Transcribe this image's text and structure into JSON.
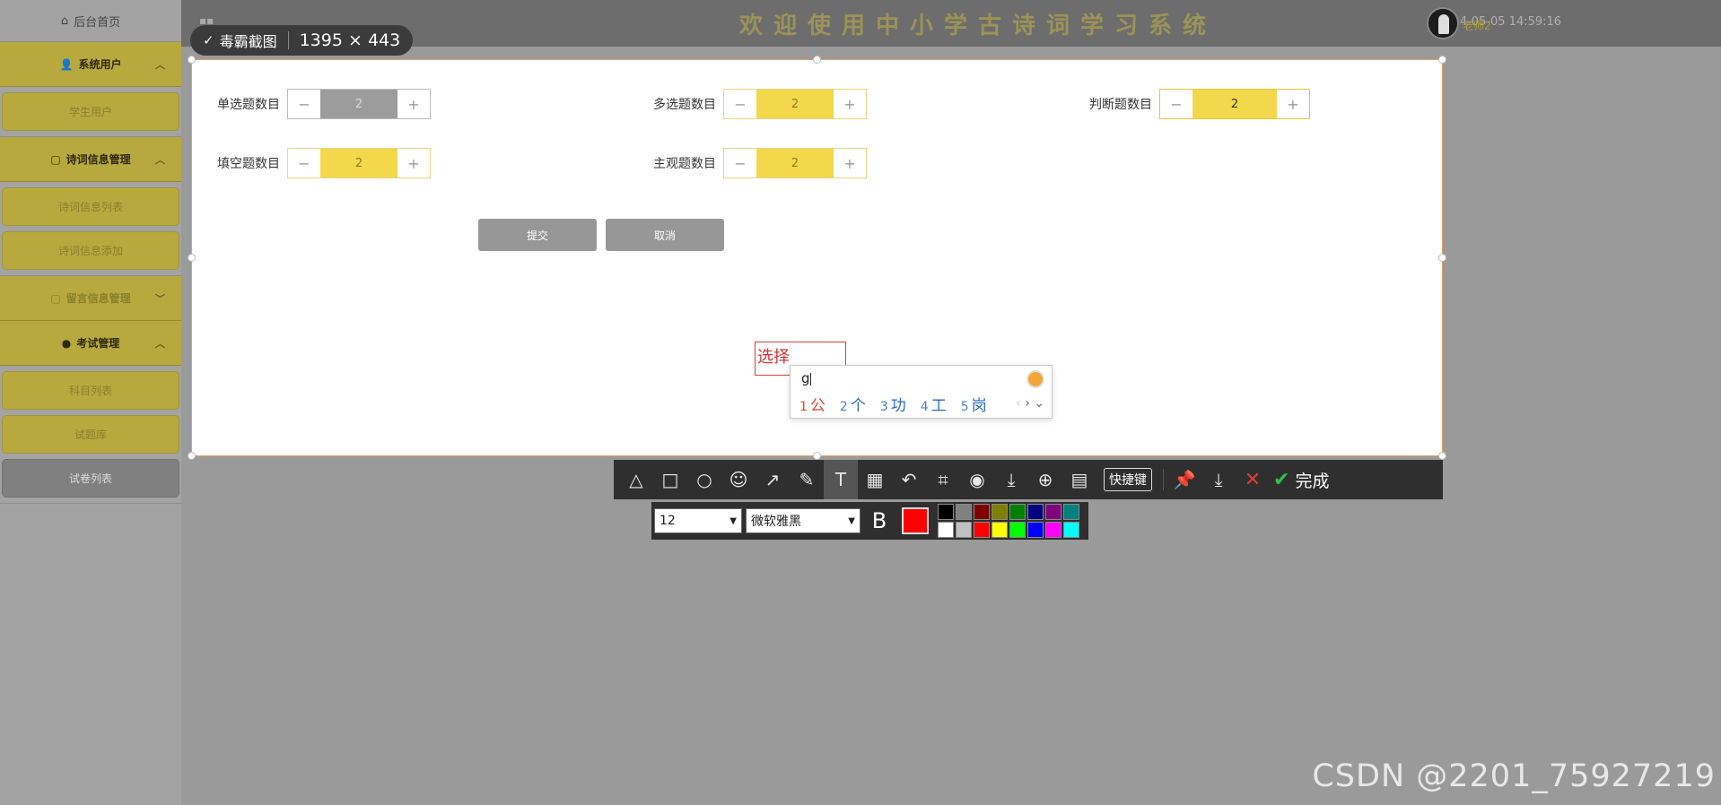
{
  "sidebar": {
    "home": "后台首页",
    "groups": [
      {
        "label": "系统用户",
        "items": [
          "学生用户"
        ]
      },
      {
        "label": "诗词信息管理",
        "items": [
          "诗词信息列表",
          "诗词信息添加"
        ]
      },
      {
        "label": "留言信息管理",
        "items": []
      },
      {
        "label": "考试管理",
        "items": [
          "科目列表",
          "试题库",
          "试卷列表"
        ]
      }
    ]
  },
  "header": {
    "title": "欢迎使用中小学古诗词学习系统",
    "datetime": "2024-05-05 14:59:16",
    "username": "老师2"
  },
  "capture": {
    "app_name": "毒霸截图",
    "dimensions": "1395 × 443"
  },
  "form": {
    "fields": [
      {
        "label": "单选题数目",
        "value": "2"
      },
      {
        "label": "多选题数目",
        "value": "2"
      },
      {
        "label": "判断题数目",
        "value": "2"
      },
      {
        "label": "填空题数目",
        "value": "2"
      },
      {
        "label": "主观题数目",
        "value": "2"
      }
    ],
    "submit": "提交",
    "cancel": "取消"
  },
  "annotation": {
    "text": "选择"
  },
  "ime": {
    "input": "g",
    "candidates": [
      {
        "n": "1",
        "w": "公"
      },
      {
        "n": "2",
        "w": "个"
      },
      {
        "n": "3",
        "w": "功"
      },
      {
        "n": "4",
        "w": "工"
      },
      {
        "n": "5",
        "w": "岗"
      }
    ]
  },
  "toolbar": {
    "shortcut_label": "快捷键",
    "done_label": "完成"
  },
  "textopts": {
    "font_size": "12",
    "font_family": "微软雅黑",
    "bold_label": "B",
    "current_color": "#ff0000",
    "palette": [
      "#000000",
      "#808080",
      "#800000",
      "#808000",
      "#008000",
      "#000080",
      "#800080",
      "#008080",
      "#ffffff",
      "#c0c0c0",
      "#ff0000",
      "#ffff00",
      "#00ff00",
      "#0000ff",
      "#ff00ff",
      "#00ffff"
    ]
  },
  "watermark": "CSDN @2201_75927219"
}
